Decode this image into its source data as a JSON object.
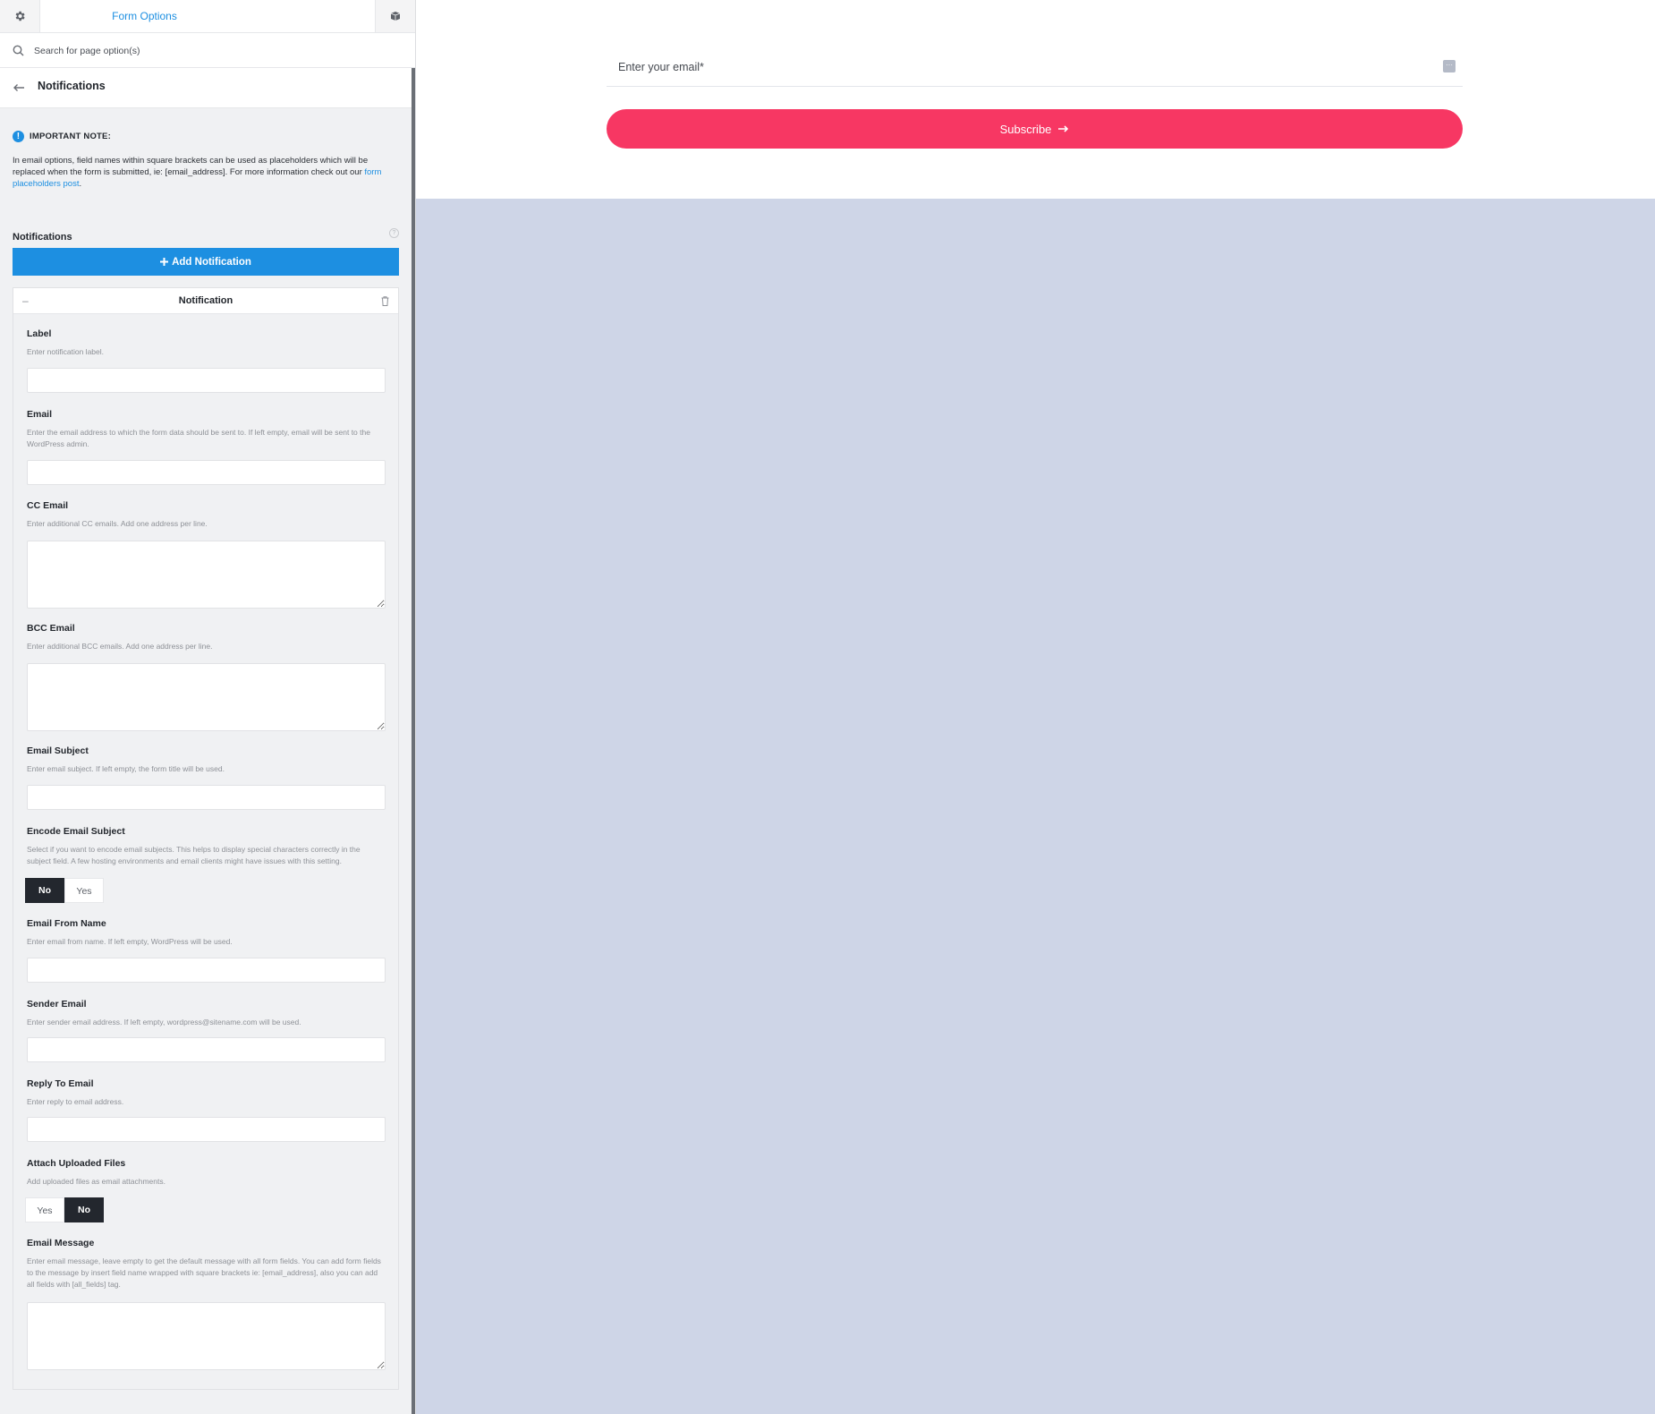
{
  "panel": {
    "tab_title": "Form Options",
    "search_placeholder": "Search for page option(s)",
    "breadcrumb_title": "Notifications",
    "note": {
      "heading": "IMPORTANT NOTE:",
      "body_before": "In email options, field names within square brackets can be used as placeholders which will be replaced when the form is submitted, ie: [email_address]. For more information check out our ",
      "link_text": "form placeholders post",
      "body_after": "."
    },
    "notifications_title": "Notifications",
    "add_button": "Add Notification",
    "card_title": "Notification",
    "fields": {
      "label": {
        "title": "Label",
        "desc": "Enter notification label."
      },
      "email": {
        "title": "Email",
        "desc": "Enter the email address to which the form data should be sent to. If left empty, email will be sent to the WordPress admin."
      },
      "cc": {
        "title": "CC Email",
        "desc": "Enter additional CC emails. Add one address per line."
      },
      "bcc": {
        "title": "BCC Email",
        "desc": "Enter additional BCC emails. Add one address per line."
      },
      "subject": {
        "title": "Email Subject",
        "desc": "Enter email subject. If left empty, the form title will be used."
      },
      "encode": {
        "title": "Encode Email Subject",
        "desc": "Select if you want to encode email subjects. This helps to display special characters correctly in the subject field. A few hosting environments and email clients might have issues with this setting.",
        "opt1": "No",
        "opt2": "Yes"
      },
      "from_name": {
        "title": "Email From Name",
        "desc": "Enter email from name. If left empty, WordPress will be used."
      },
      "sender": {
        "title": "Sender Email",
        "desc": "Enter sender email address. If left empty, wordpress@sitename.com will be used."
      },
      "reply": {
        "title": "Reply To Email",
        "desc": "Enter reply to email address."
      },
      "attach": {
        "title": "Attach Uploaded Files",
        "desc": "Add uploaded files as email attachments.",
        "opt1": "Yes",
        "opt2": "No"
      },
      "message": {
        "title": "Email Message",
        "desc": "Enter email message, leave empty to get the default message with all form fields. You can add form fields to the message by insert field name wrapped with square brackets ie: [email_address], also you can add all fields with [all_fields] tag."
      }
    }
  },
  "preview": {
    "email_placeholder": "Enter your email*",
    "subscribe_label": "Subscribe",
    "subscribe_color": "#f73763",
    "background_color": "#ced5e7"
  }
}
